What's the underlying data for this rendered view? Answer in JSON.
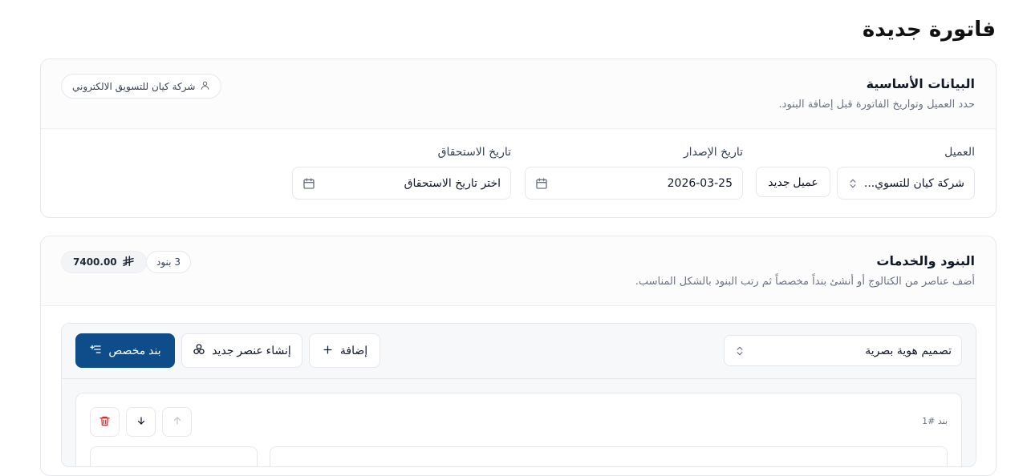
{
  "page": {
    "title": "فاتورة جديدة"
  },
  "basic": {
    "title": "البيانات الأساسية",
    "description": "حدد العميل وتواريخ الفاتورة قبل إضافة البنود.",
    "client_pill": "شركة كيان للتسويق الالكتروني",
    "client": {
      "label": "العميل",
      "value": "شركة كيان للتسوي..."
    },
    "new_client_button": "عميل جديد",
    "issue_date": {
      "label": "تاريخ الإصدار",
      "value": "2026-03-25"
    },
    "due_date": {
      "label": "تاريخ الاستحقاق",
      "placeholder": "اختر تاريخ الاستحقاق"
    }
  },
  "items": {
    "title": "البنود والخدمات",
    "description": "أضف عناصر من الكتالوج أو أنشئ بنداً مخصصاً ثم رتب البنود بالشكل المناسب.",
    "count_badge": "3 بنود",
    "total": "7400.00",
    "catalog_select": "تصميم هوية بصرية",
    "add_button": "إضافة",
    "create_item_button": "إنشاء عنصر جديد",
    "custom_item_button": "بند مخصص",
    "item_label": "بند #1"
  },
  "colors": {
    "primary": "#0f4c8a",
    "danger": "#dc2626",
    "border": "#e5e7eb",
    "muted": "#6b7280"
  },
  "icons": [
    "user-icon",
    "calendar-icon",
    "chevrons-updown-icon",
    "riyal-icon",
    "plus-icon",
    "component-icon",
    "list-plus-icon",
    "arrow-up-icon",
    "arrow-down-icon",
    "trash-icon"
  ]
}
